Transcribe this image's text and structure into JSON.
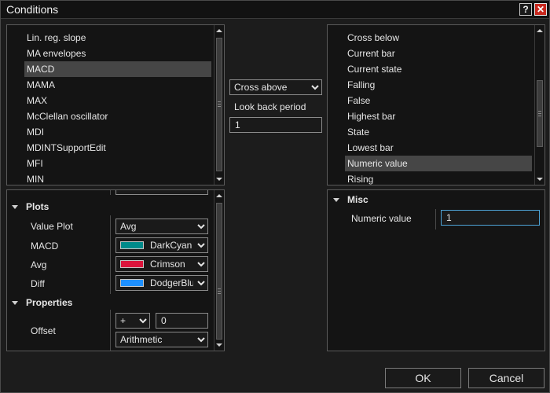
{
  "window": {
    "title": "Conditions"
  },
  "left_list": {
    "items": [
      "Lin. reg. slope",
      "MA envelopes",
      "MACD",
      "MAMA",
      "MAX",
      "McClellan oscillator",
      "MDI",
      "MDINTSupportEdit",
      "MFI",
      "MIN"
    ],
    "selected": "MACD"
  },
  "middle": {
    "operator": "Cross above",
    "lookback_label": "Look back period",
    "lookback_value": "1"
  },
  "right_list": {
    "items": [
      "Cross below",
      "Current bar",
      "Current state",
      "Falling",
      "False",
      "Highest bar",
      "State",
      "Lowest bar",
      "Numeric value",
      "Rising"
    ],
    "selected": "Numeric value"
  },
  "left_props": {
    "plots_header": "Plots",
    "value_plot_label": "Value Plot",
    "value_plot_value": "Avg",
    "macd_label": "MACD",
    "macd_color_name": "DarkCyan",
    "avg_label": "Avg",
    "avg_color_name": "Crimson",
    "diff_label": "Diff",
    "diff_color_name": "DodgerBlue",
    "properties_header": "Properties",
    "offset_label": "Offset",
    "offset_operator": "+",
    "offset_value": "0",
    "offset_type": "Arithmetic"
  },
  "right_props": {
    "misc_header": "Misc",
    "numeric_value_label": "Numeric value",
    "numeric_value": "1"
  },
  "footer": {
    "ok_label": "OK",
    "cancel_label": "Cancel"
  },
  "colors": {
    "macd": "#008b8b",
    "avg": "#dc143c",
    "diff": "#1e90ff",
    "focus_border": "#4ea3d6"
  }
}
